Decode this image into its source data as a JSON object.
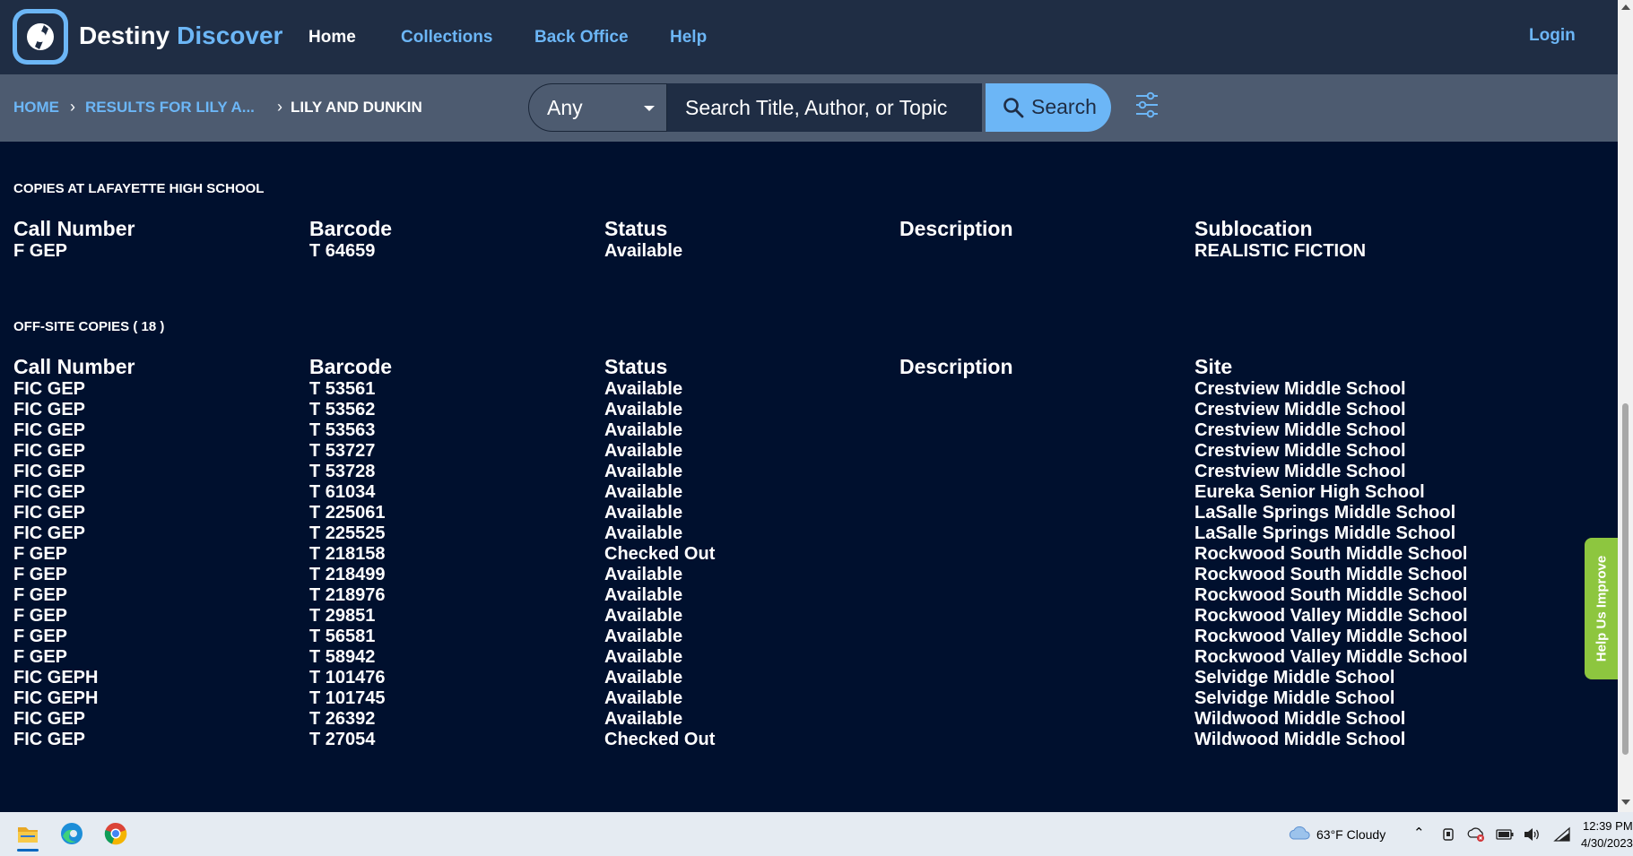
{
  "brand": {
    "name_part1": "Destiny",
    "name_part2": "Discover"
  },
  "nav": {
    "home": "Home",
    "collections": "Collections",
    "back_office": "Back Office",
    "help": "Help",
    "login": "Login"
  },
  "breadcrumb": {
    "home": "HOME",
    "results": "RESULTS FOR LILY A...",
    "current": "LILY AND DUNKIN"
  },
  "search": {
    "scope": "Any",
    "placeholder": "Search Title, Author, or Topic",
    "button": "Search"
  },
  "local_copies": {
    "title": "COPIES AT LAFAYETTE HIGH SCHOOL",
    "headers": [
      "Call Number",
      "Barcode",
      "Status",
      "Description",
      "Sublocation"
    ],
    "rows": [
      [
        "F GEP",
        "T 64659",
        "Available",
        "",
        "REALISTIC FICTION"
      ]
    ]
  },
  "offsite_copies": {
    "title": "OFF-SITE COPIES ( 18 )",
    "headers": [
      "Call Number",
      "Barcode",
      "Status",
      "Description",
      "Site"
    ],
    "rows": [
      [
        "FIC GEP",
        "T 53561",
        "Available",
        "",
        "Crestview Middle School"
      ],
      [
        "FIC GEP",
        "T 53562",
        "Available",
        "",
        "Crestview Middle School"
      ],
      [
        "FIC GEP",
        "T 53563",
        "Available",
        "",
        "Crestview Middle School"
      ],
      [
        "FIC GEP",
        "T 53727",
        "Available",
        "",
        "Crestview Middle School"
      ],
      [
        "FIC GEP",
        "T 53728",
        "Available",
        "",
        "Crestview Middle School"
      ],
      [
        "FIC GEP",
        "T 61034",
        "Available",
        "",
        "Eureka Senior High School"
      ],
      [
        "FIC GEP",
        "T 225061",
        "Available",
        "",
        "LaSalle Springs Middle School"
      ],
      [
        "FIC GEP",
        "T 225525",
        "Available",
        "",
        "LaSalle Springs Middle School"
      ],
      [
        "F GEP",
        "T 218158",
        "Checked Out",
        "",
        "Rockwood South Middle School"
      ],
      [
        "F GEP",
        "T 218499",
        "Available",
        "",
        "Rockwood South Middle School"
      ],
      [
        "F GEP",
        "T 218976",
        "Available",
        "",
        "Rockwood South Middle School"
      ],
      [
        "F GEP",
        "T 29851",
        "Available",
        "",
        "Rockwood Valley Middle School"
      ],
      [
        "F GEP",
        "T 56581",
        "Available",
        "",
        "Rockwood Valley Middle School"
      ],
      [
        "F GEP",
        "T 58942",
        "Available",
        "",
        "Rockwood Valley Middle School"
      ],
      [
        "FIC GEPH",
        "T 101476",
        "Available",
        "",
        "Selvidge Middle School"
      ],
      [
        "FIC GEPH",
        "T 101745",
        "Available",
        "",
        "Selvidge Middle School"
      ],
      [
        "FIC GEP",
        "T 26392",
        "Available",
        "",
        "Wildwood Middle School"
      ],
      [
        "FIC GEP",
        "T 27054",
        "Checked Out",
        "",
        "Wildwood Middle School"
      ]
    ]
  },
  "help_tab": "Help Us Improve",
  "taskbar": {
    "weather": "63°F  Cloudy",
    "time": "12:39 PM",
    "date": "4/30/2023",
    "apps": [
      "file-explorer-icon",
      "edge-icon",
      "chrome-icon"
    ]
  },
  "colors": {
    "page_bg": "#00102e",
    "nav_bg": "#1f2d44",
    "subbar_bg": "#4d5b70",
    "accent": "#6cb6f6",
    "help_tab": "#8dc63f"
  }
}
